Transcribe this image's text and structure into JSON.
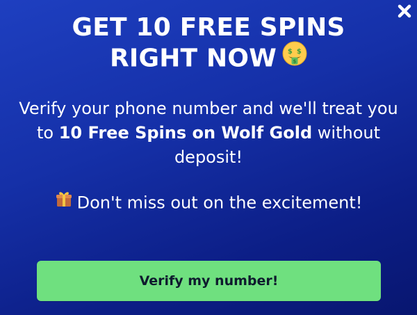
{
  "modal": {
    "headline_line1": "GET 10 FREE SPINS",
    "headline_line2": "RIGHT NOW",
    "headline_emoji": "money-mouth-face-icon",
    "body_part1": "Verify your phone number and we'll treat you to ",
    "body_bold": "10 Free Spins on Wolf Gold",
    "body_part2": " without deposit!",
    "tagline_icon": "gift-icon",
    "tagline": "Don't miss out on the excitement!",
    "cta_label": "Verify my number!",
    "close_icon": "close-icon"
  },
  "colors": {
    "background_top": "#1e3fc0",
    "background_bottom": "#081670",
    "button": "#6fe07f",
    "button_text": "#0f1b2e",
    "text": "#ffffff"
  }
}
